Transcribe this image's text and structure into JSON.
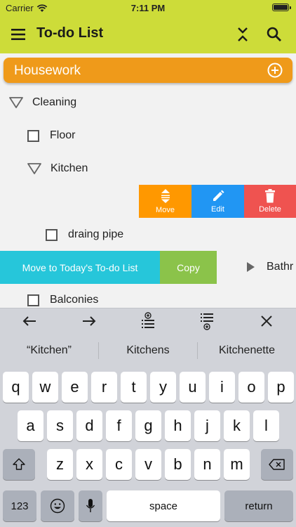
{
  "status": {
    "carrier": "Carrier",
    "time": "7:11 PM"
  },
  "app_bar": {
    "title": "To-do List"
  },
  "group": {
    "title": "Housework"
  },
  "tree": {
    "cleaning": "Cleaning",
    "floor": "Floor",
    "kitchen": "Kitchen",
    "draining_pipe": "draing pipe",
    "bathroom": "Bathr",
    "balconies": "Balconies"
  },
  "swipe_actions": {
    "move": "Move",
    "edit": "Edit",
    "delete": "Delete"
  },
  "swipe_left_actions": {
    "move_today": "Move to Today's To-do List",
    "copy": "Copy"
  },
  "keyboard": {
    "suggestions": [
      "“Kitchen”",
      "Kitchens",
      "Kitchenette"
    ],
    "row1": [
      "q",
      "w",
      "e",
      "r",
      "t",
      "y",
      "u",
      "i",
      "o",
      "p"
    ],
    "row2": [
      "a",
      "s",
      "d",
      "f",
      "g",
      "h",
      "j",
      "k",
      "l"
    ],
    "row3": [
      "z",
      "x",
      "c",
      "v",
      "b",
      "n",
      "m"
    ],
    "numbers_key": "123",
    "space_key": "space",
    "return_key": "return"
  },
  "colors": {
    "app_bar": "#cddc39",
    "group": "#ef9a1a",
    "move": "#ff9800",
    "edit": "#2196f3",
    "delete": "#ef5350",
    "today": "#26c6da",
    "copy": "#8bc34a"
  }
}
